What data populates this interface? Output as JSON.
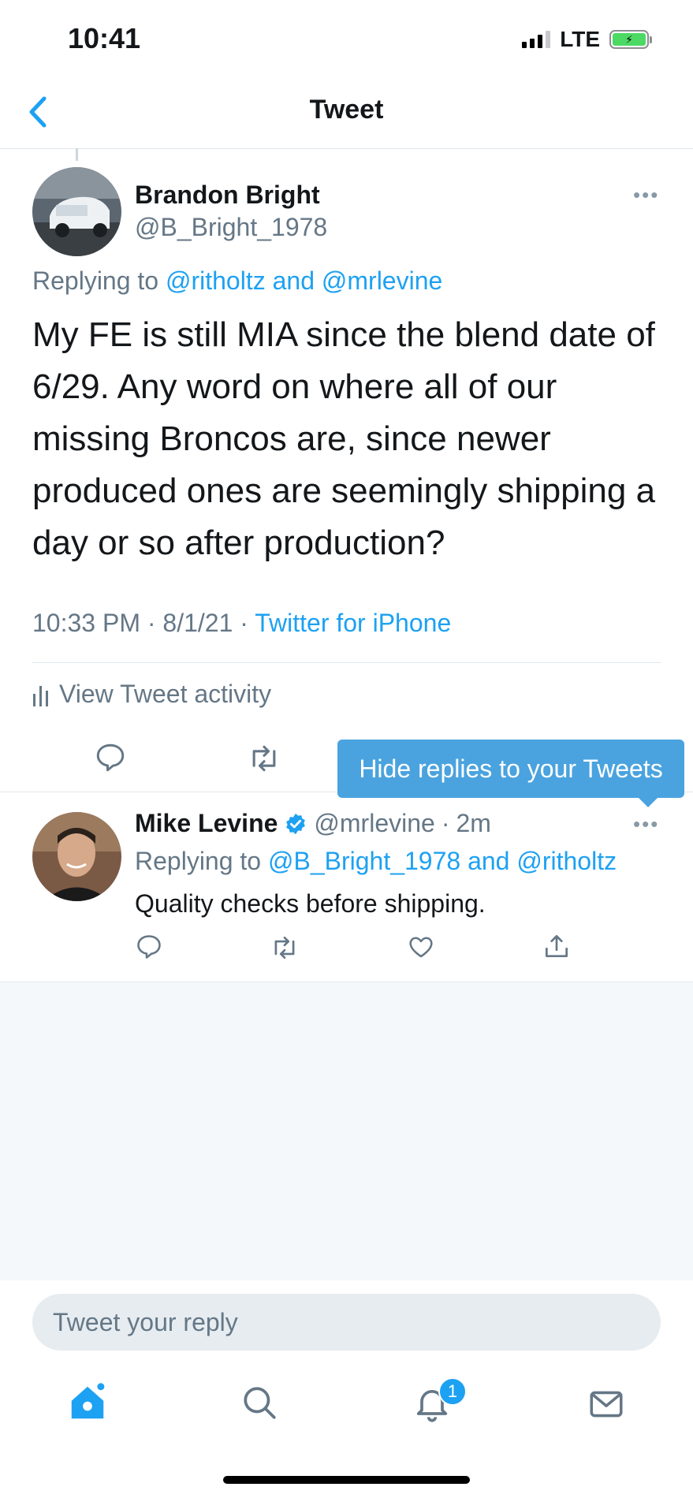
{
  "status_bar": {
    "time": "10:41",
    "network": "LTE"
  },
  "header": {
    "title": "Tweet"
  },
  "tweet": {
    "author_name": "Brandon Bright",
    "author_handle": "@B_Bright_1978",
    "replying_prefix": "Replying to",
    "replying_to": "@ritholtz and @mrlevine",
    "text": "My FE is still MIA since the blend date of 6/29.   Any word on where all of our missing Broncos are, since newer produced ones are seemingly shipping a day or so after production?",
    "time": "10:33 PM",
    "date": "8/1/21",
    "source": "Twitter for iPhone",
    "activity_label": "View Tweet activity"
  },
  "tooltip": {
    "text": "Hide replies to your Tweets"
  },
  "reply": {
    "author_name": "Mike Levine",
    "author_handle": "@mrlevine",
    "age": "2m",
    "replying_prefix": "Replying to",
    "replying_to": "@B_Bright_1978 and @ritholtz",
    "text": "Quality checks before shipping."
  },
  "compose": {
    "placeholder": "Tweet your reply"
  },
  "tabs": [
    {
      "icon": "home-icon"
    },
    {
      "icon": "search-icon"
    },
    {
      "icon": "notifications-icon",
      "badge": "1"
    },
    {
      "icon": "messages-icon"
    }
  ],
  "colors": {
    "accent": "#1da1f2",
    "tooltip": "#4aa3df",
    "muted": "#657786"
  }
}
